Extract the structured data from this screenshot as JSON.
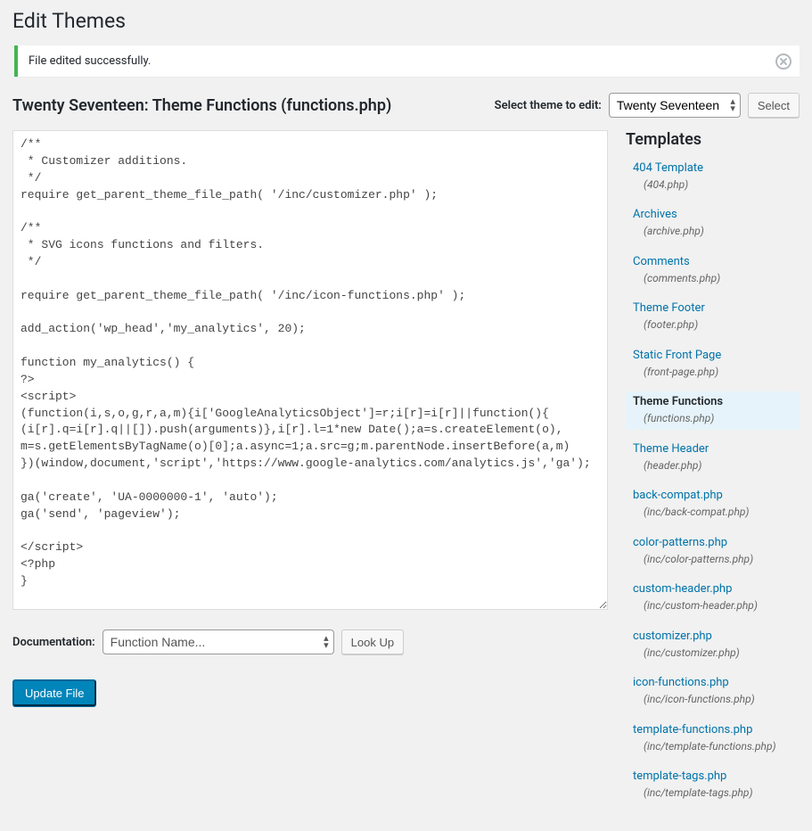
{
  "page_title": "Edit Themes",
  "notice": {
    "message": "File edited successfully."
  },
  "file_heading": "Twenty Seventeen: Theme Functions (functions.php)",
  "theme_select": {
    "label": "Select theme to edit:",
    "selected": "Twenty Seventeen",
    "button": "Select"
  },
  "editor_text": "/**\n * Customizer additions.\n */\nrequire get_parent_theme_file_path( '/inc/customizer.php' );\n\n/**\n * SVG icons functions and filters.\n */\n\nrequire get_parent_theme_file_path( '/inc/icon-functions.php' );\n\nadd_action('wp_head','my_analytics', 20);\n\nfunction my_analytics() {\n?>\n<script>\n(function(i,s,o,g,r,a,m){i['GoogleAnalyticsObject']=r;i[r]=i[r]||function(){\n(i[r].q=i[r].q||[]).push(arguments)},i[r].l=1*new Date();a=s.createElement(o),\nm=s.getElementsByTagName(o)[0];a.async=1;a.src=g;m.parentNode.insertBefore(a,m)\n})(window,document,'script','https://www.google-analytics.com/analytics.js','ga');\n\nga('create', 'UA-0000000-1', 'auto');\nga('send', 'pageview');\n\n</script>\n<?php\n}",
  "documentation": {
    "label": "Documentation:",
    "placeholder": "Function Name...",
    "button": "Look Up"
  },
  "submit_button": "Update File",
  "sidebar_heading": "Templates",
  "templates": [
    {
      "title": "404 Template",
      "file": "(404.php)",
      "active": false
    },
    {
      "title": "Archives",
      "file": "(archive.php)",
      "active": false
    },
    {
      "title": "Comments",
      "file": "(comments.php)",
      "active": false
    },
    {
      "title": "Theme Footer",
      "file": "(footer.php)",
      "active": false
    },
    {
      "title": "Static Front Page",
      "file": "(front-page.php)",
      "active": false
    },
    {
      "title": "Theme Functions",
      "file": "(functions.php)",
      "active": true
    },
    {
      "title": "Theme Header",
      "file": "(header.php)",
      "active": false
    },
    {
      "title": "back-compat.php",
      "file": "(inc/back-compat.php)",
      "active": false
    },
    {
      "title": "color-patterns.php",
      "file": "(inc/color-patterns.php)",
      "active": false
    },
    {
      "title": "custom-header.php",
      "file": "(inc/custom-header.php)",
      "active": false
    },
    {
      "title": "customizer.php",
      "file": "(inc/customizer.php)",
      "active": false
    },
    {
      "title": "icon-functions.php",
      "file": "(inc/icon-functions.php)",
      "active": false
    },
    {
      "title": "template-functions.php",
      "file": "(inc/template-functions.php)",
      "active": false
    },
    {
      "title": "template-tags.php",
      "file": "(inc/template-tags.php)",
      "active": false
    }
  ]
}
